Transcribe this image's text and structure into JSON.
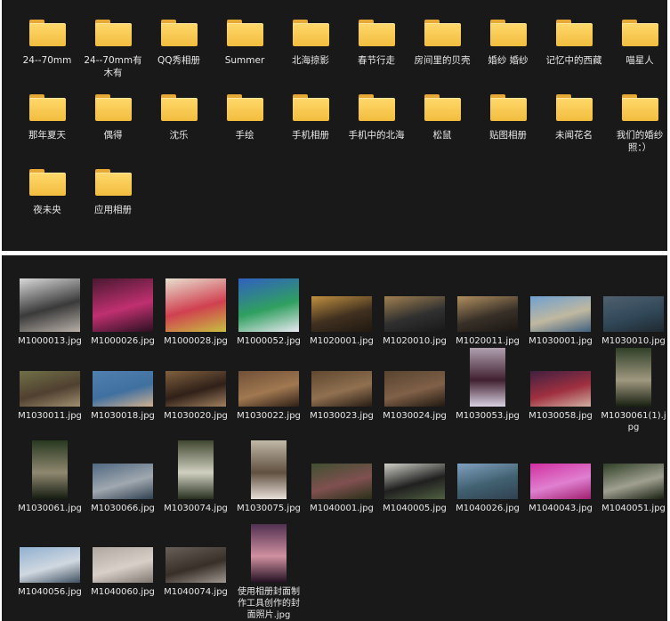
{
  "folders": [
    {
      "name": "24--70mm"
    },
    {
      "name": "24--70mm有木有"
    },
    {
      "name": "QQ秀相册"
    },
    {
      "name": "Summer"
    },
    {
      "name": "北海掠影"
    },
    {
      "name": "春节行走"
    },
    {
      "name": "房间里的贝壳"
    },
    {
      "name": "婚纱 婚纱"
    },
    {
      "name": "记忆中的西藏"
    },
    {
      "name": "喵星人"
    },
    {
      "name": "那年夏天"
    },
    {
      "name": "偶得"
    },
    {
      "name": "沈乐"
    },
    {
      "name": "手绘"
    },
    {
      "name": "手机相册"
    },
    {
      "name": "手机中的北海"
    },
    {
      "name": "松鼠"
    },
    {
      "name": "贴图相册"
    },
    {
      "name": "未闻花名"
    },
    {
      "name": "我们的婚纱照：）"
    },
    {
      "name": "夜未央"
    },
    {
      "name": "应用相册"
    }
  ],
  "images": [
    {
      "name": "M1000013.jpg",
      "orientation": "landscape",
      "colors": [
        "#d9d9d9",
        "#3a3a3a",
        "#b8b0a8"
      ]
    },
    {
      "name": "M1000026.jpg",
      "orientation": "landscape",
      "colors": [
        "#4a1830",
        "#c03070",
        "#2a1020"
      ]
    },
    {
      "name": "M1000028.jpg",
      "orientation": "landscape",
      "colors": [
        "#e8e0d0",
        "#d04050",
        "#c8c040"
      ]
    },
    {
      "name": "M1000052.jpg",
      "orientation": "landscape",
      "colors": [
        "#3060c0",
        "#30a060",
        "#e8e8f0"
      ]
    },
    {
      "name": "M1020001.jpg",
      "orientation": "landscape",
      "colors": [
        "#c09040",
        "#403020",
        "#201810"
      ]
    },
    {
      "name": "M1020010.jpg",
      "orientation": "landscape",
      "colors": [
        "#a08050",
        "#303030",
        "#181818"
      ]
    },
    {
      "name": "M1020011.jpg",
      "orientation": "landscape",
      "colors": [
        "#b09060",
        "#383028",
        "#1a1612"
      ]
    },
    {
      "name": "M1030001.jpg",
      "orientation": "landscape",
      "colors": [
        "#70a0d0",
        "#c0b8a0",
        "#406080"
      ]
    },
    {
      "name": "M1030010.jpg",
      "orientation": "landscape",
      "colors": [
        "#506070",
        "#304858",
        "#202830"
      ]
    },
    {
      "name": "M1030011.jpg",
      "orientation": "landscape",
      "colors": [
        "#707048",
        "#504030",
        "#a09070"
      ]
    },
    {
      "name": "M1030018.jpg",
      "orientation": "landscape",
      "colors": [
        "#5080b0",
        "#4070a0",
        "#d0b090"
      ]
    },
    {
      "name": "M1030020.jpg",
      "orientation": "landscape",
      "colors": [
        "#806040",
        "#302018",
        "#a08060"
      ]
    },
    {
      "name": "M1030022.jpg",
      "orientation": "landscape",
      "colors": [
        "#705038",
        "#a07850",
        "#302018"
      ]
    },
    {
      "name": "M1030023.jpg",
      "orientation": "landscape",
      "colors": [
        "#604830",
        "#907050",
        "#281c14"
      ]
    },
    {
      "name": "M1030024.jpg",
      "orientation": "landscape",
      "colors": [
        "#584430",
        "#806048",
        "#201810"
      ]
    },
    {
      "name": "M1030053.jpg",
      "orientation": "portrait",
      "colors": [
        "#b0a0b0",
        "#402030",
        "#d8d0e0"
      ]
    },
    {
      "name": "M1030058.jpg",
      "orientation": "landscape",
      "colors": [
        "#402040",
        "#a03040",
        "#d0b0a0"
      ]
    },
    {
      "name": "M1030061(1).jpg",
      "orientation": "portrait",
      "colors": [
        "#304028",
        "#a09880",
        "#182010"
      ]
    },
    {
      "name": "M1030061.jpg",
      "orientation": "portrait",
      "colors": [
        "#283820",
        "#908870",
        "#141c10"
      ]
    },
    {
      "name": "M1030066.jpg",
      "orientation": "landscape",
      "colors": [
        "#506880",
        "#a0a8b0",
        "#304050"
      ]
    },
    {
      "name": "M1030074.jpg",
      "orientation": "portrait",
      "colors": [
        "#404830",
        "#d0d0c0",
        "#283020"
      ]
    },
    {
      "name": "M1030075.jpg",
      "orientation": "portrait",
      "colors": [
        "#c0b8a8",
        "#605040",
        "#e8e0d8"
      ]
    },
    {
      "name": "M1040001.jpg",
      "orientation": "landscape",
      "colors": [
        "#405030",
        "#805050",
        "#283018"
      ]
    },
    {
      "name": "M1040005.jpg",
      "orientation": "landscape",
      "colors": [
        "#d0d0c8",
        "#202020",
        "#506040"
      ]
    },
    {
      "name": "M1040026.jpg",
      "orientation": "landscape",
      "colors": [
        "#80a0c0",
        "#406070",
        "#304050"
      ]
    },
    {
      "name": "M1040043.jpg",
      "orientation": "landscape",
      "colors": [
        "#d030a0",
        "#e080d0",
        "#a02070"
      ]
    },
    {
      "name": "M1040051.jpg",
      "orientation": "landscape",
      "colors": [
        "#304028",
        "#a0a090",
        "#182010"
      ]
    },
    {
      "name": "M1040056.jpg",
      "orientation": "landscape",
      "colors": [
        "#90b0d0",
        "#d0d8e0",
        "#405060"
      ]
    },
    {
      "name": "M1040060.jpg",
      "orientation": "landscape",
      "colors": [
        "#b0a8a0",
        "#d8d0c8",
        "#807870"
      ]
    },
    {
      "name": "M1040074.jpg",
      "orientation": "landscape",
      "colors": [
        "#686058",
        "#383028",
        "#a09890"
      ]
    },
    {
      "name": "使用相册封面制作工具创作的封面照片.jpg",
      "orientation": "portrait",
      "colors": [
        "#503050",
        "#d090a0",
        "#201020"
      ]
    }
  ]
}
